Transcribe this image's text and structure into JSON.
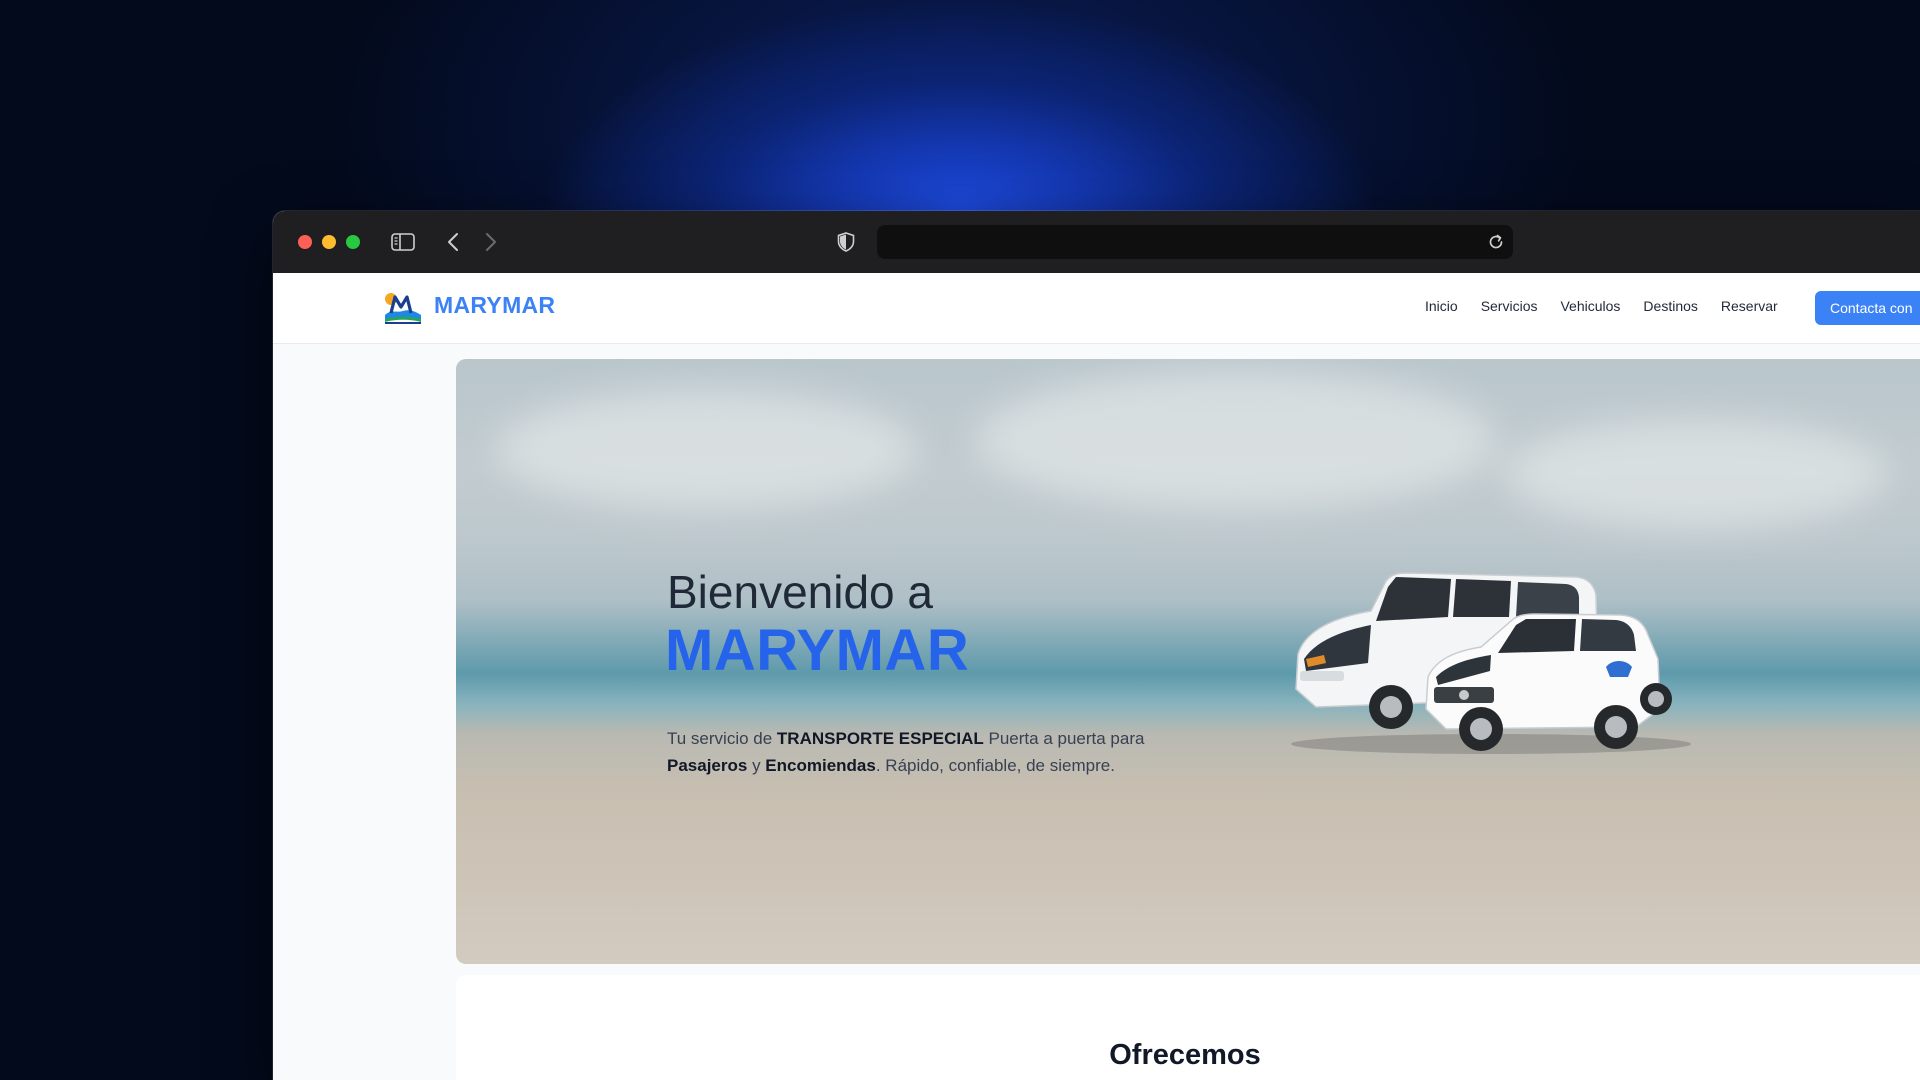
{
  "browser": {
    "url": "",
    "icons": {
      "sidebar_toggle": "sidebar-icon",
      "back": "chevron-left-icon",
      "forward": "chevron-right-icon",
      "privacy": "shield-icon",
      "reload": "reload-icon"
    }
  },
  "navbar": {
    "brand": "MARYMAR",
    "links": [
      "Inicio",
      "Servicios",
      "Vehiculos",
      "Destinos",
      "Reservar"
    ],
    "cta": "Contacta con"
  },
  "hero": {
    "title_line1": "Bienvenido a",
    "title_line2": "MARYMAR",
    "desc": {
      "p1": "Tu servicio de ",
      "b1": "TRANSPORTE ESPECIAL",
      "p2": " Puerta a puerta para ",
      "b2": "Pasajeros",
      "p3": " y ",
      "b3": "Encomiendas",
      "p4": ". Rápido, confiable, de siempre."
    }
  },
  "offer": {
    "title": "Ofrecemos"
  },
  "colors": {
    "accent": "#3b82f6",
    "hero_title": "#2563eb"
  }
}
